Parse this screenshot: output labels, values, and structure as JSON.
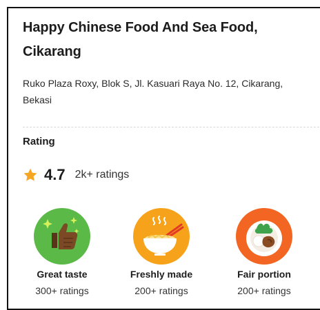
{
  "restaurant": {
    "name_line1": "Happy Chinese Food And Sea Food,",
    "name_line2": "Cikarang",
    "address_line1": "Ruko Plaza Roxy, Blok S, Jl. Kasuari Raya No. 12, Cikarang,",
    "address_line2": "Bekasi"
  },
  "rating": {
    "heading": "Rating",
    "score": "4.7",
    "count": "2k+ ratings",
    "star_color": "#f5a623"
  },
  "badges": [
    {
      "icon": "thumbs-up-icon",
      "title": "Great taste",
      "subtitle": "300+ ratings",
      "color": "#5bb947"
    },
    {
      "icon": "noodle-bowl-icon",
      "title": "Freshly made",
      "subtitle": "200+ ratings",
      "color": "#f7a21b"
    },
    {
      "icon": "food-plate-icon",
      "title": "Fair portion",
      "subtitle": "200+ ratings",
      "color": "#f26522"
    }
  ]
}
